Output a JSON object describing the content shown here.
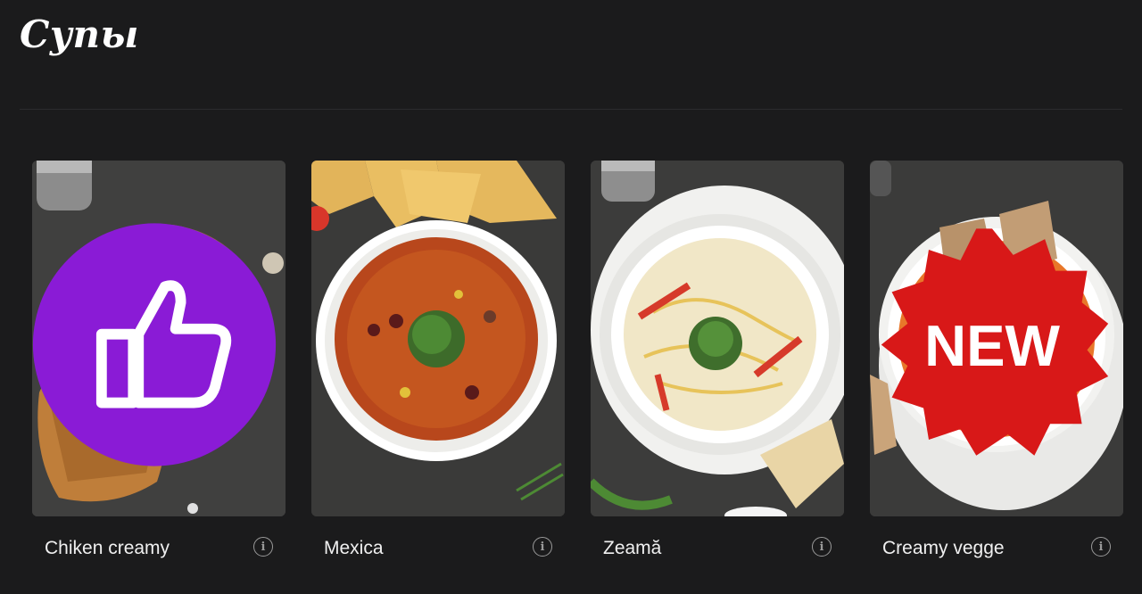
{
  "page": {
    "title": "Супы"
  },
  "colors": {
    "background": "#1b1b1c",
    "like_badge": "#8a1bd6",
    "new_badge": "#d81818",
    "text": "#f0f0f0",
    "info_icon": "#9a9a9a"
  },
  "products": [
    {
      "name": "Chiken creamy",
      "badge": "thumbs-up-icon",
      "image": "soup-in-bread-bowl"
    },
    {
      "name": "Mexica",
      "badge": "",
      "image": "red-bean-soup-with-nachos"
    },
    {
      "name": "Zeamă",
      "badge": "",
      "image": "chicken-noodle-soup"
    },
    {
      "name": "Creamy vegge",
      "badge": "NEW",
      "image": "pumpkin-cream-soup"
    }
  ],
  "info_icon": "i"
}
